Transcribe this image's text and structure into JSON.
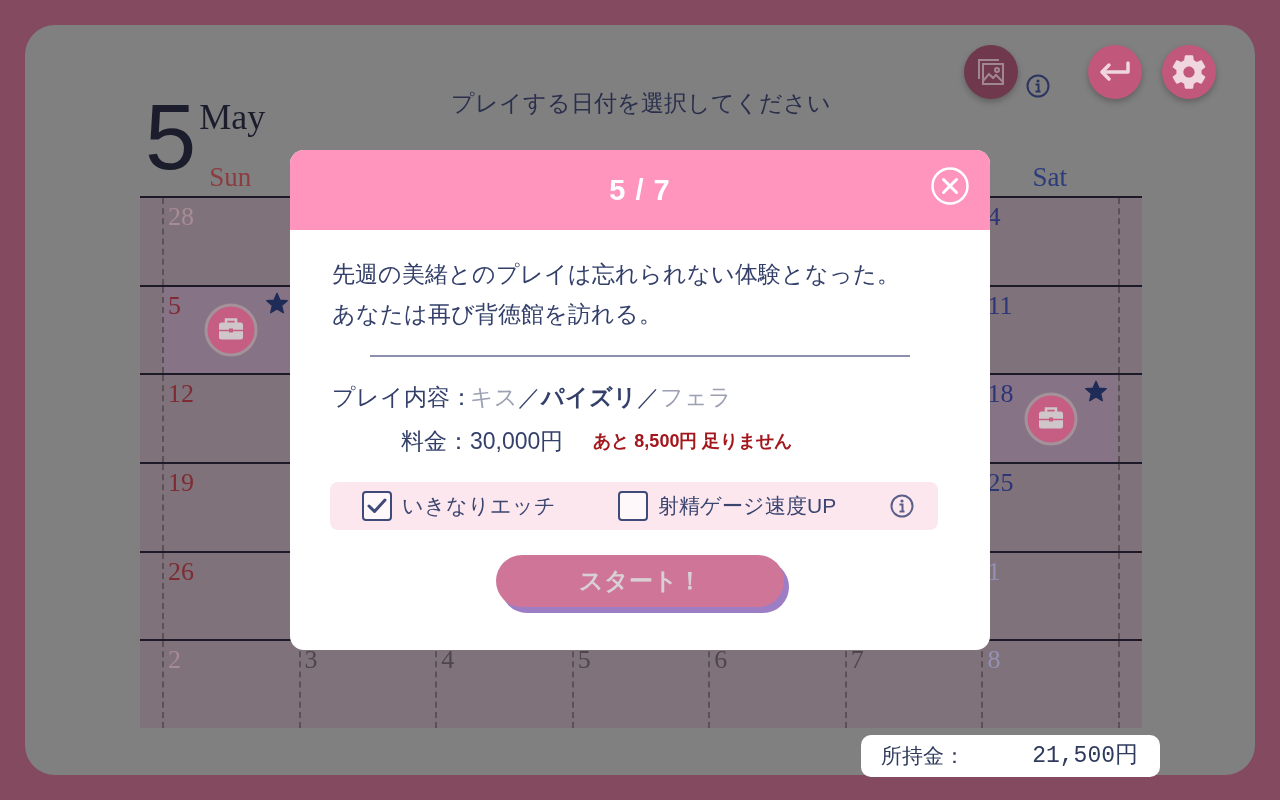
{
  "toolbar": {
    "buttons": [
      {
        "kind": "gallery",
        "disabled": true
      },
      {
        "kind": "info",
        "disabled": false
      },
      {
        "kind": "back",
        "disabled": false
      },
      {
        "kind": "settings",
        "disabled": false
      }
    ]
  },
  "header": {
    "day": "5",
    "month": "May",
    "instruction": "プレイする日付を選択してください"
  },
  "calendar": {
    "weekdays": [
      {
        "label": "Sun",
        "kind": "sunday"
      },
      {
        "label": "Sat",
        "kind": "saturday"
      }
    ],
    "weeks": [
      {
        "days": [
          {
            "date": "28",
            "kind": "sunday",
            "outside_month": true,
            "event": false,
            "starred": false
          },
          {
            "date": "4",
            "kind": "saturday",
            "outside_month": false,
            "event": false,
            "starred": false
          }
        ]
      },
      {
        "days": [
          {
            "date": "5",
            "kind": "sunday",
            "outside_month": false,
            "event": true,
            "starred": true
          },
          {
            "date": "11",
            "kind": "saturday",
            "outside_month": false,
            "event": false,
            "starred": false
          }
        ]
      },
      {
        "days": [
          {
            "date": "12",
            "kind": "sunday",
            "outside_month": false,
            "event": false,
            "starred": false
          },
          {
            "date": "18",
            "kind": "saturday",
            "outside_month": false,
            "event": true,
            "starred": true
          }
        ]
      },
      {
        "days": [
          {
            "date": "19",
            "kind": "sunday",
            "outside_month": false,
            "event": false,
            "starred": false
          },
          {
            "date": "25",
            "kind": "saturday",
            "outside_month": false,
            "event": false,
            "starred": false
          }
        ]
      },
      {
        "days": [
          {
            "date": "26",
            "kind": "sunday",
            "outside_month": false,
            "event": false,
            "starred": false
          },
          {
            "date": "1",
            "kind": "saturday",
            "outside_month": true,
            "event": false,
            "starred": false
          }
        ]
      },
      {
        "days": [
          {
            "date": "2",
            "kind": "sunday",
            "outside_month": true,
            "event": false,
            "starred": false
          },
          {
            "date": "3",
            "kind": "weekday",
            "outside_month": true,
            "event": false,
            "starred": false
          },
          {
            "date": "4",
            "kind": "weekday",
            "outside_month": true,
            "event": false,
            "starred": false
          },
          {
            "date": "5",
            "kind": "weekday",
            "outside_month": true,
            "event": false,
            "starred": false
          },
          {
            "date": "6",
            "kind": "weekday",
            "outside_month": true,
            "event": false,
            "starred": false
          },
          {
            "date": "7",
            "kind": "weekday",
            "outside_month": true,
            "event": false,
            "starred": false
          },
          {
            "date": "8",
            "kind": "saturday",
            "outside_month": true,
            "event": false,
            "starred": false
          }
        ]
      }
    ]
  },
  "dialog": {
    "title": "5 / 7",
    "message_lines": [
      "先週の美緒とのプレイは忘れられない体験となった。",
      "あなたは再び背徳館を訪れる。"
    ],
    "play": {
      "label": "プレイ内容：",
      "separator": "／",
      "items": [
        {
          "label": "キス",
          "selected": false
        },
        {
          "label": "パイズリ",
          "selected": true
        },
        {
          "label": "フェラ",
          "selected": false
        }
      ]
    },
    "price": {
      "label": "料金：",
      "value": "30,000円",
      "warning": "あと 8,500円 足りません"
    },
    "options": [
      {
        "label": "いきなりエッチ",
        "checked": true
      },
      {
        "label": "射精ゲージ速度UP",
        "checked": false
      }
    ],
    "start_button": {
      "label": "スタート！",
      "disabled": true
    }
  },
  "wallet": {
    "label": "所持金：",
    "value": "21,500円"
  }
}
